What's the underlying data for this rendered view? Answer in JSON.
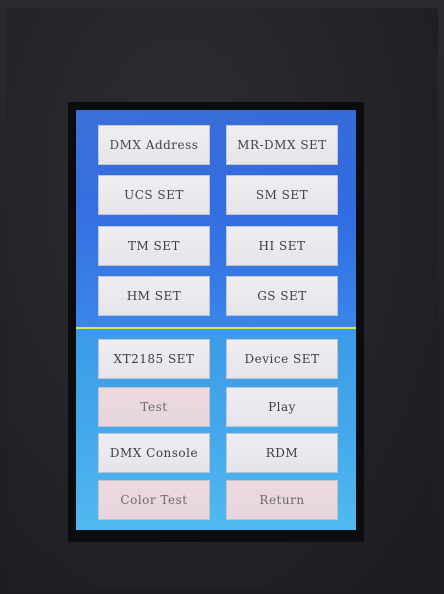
{
  "colors": {
    "screen_top": "#2f66d6",
    "screen_bottom": "#44a8ec",
    "divider": "#e8e437",
    "button_face": "#e8e8ee",
    "button_text": "#3a3d48"
  },
  "menu": {
    "buttons": [
      {
        "label": "DMX Address"
      },
      {
        "label": "MR-DMX SET"
      },
      {
        "label": "UCS SET"
      },
      {
        "label": "SM SET"
      },
      {
        "label": "TM SET"
      },
      {
        "label": "HI SET"
      },
      {
        "label": "HM SET"
      },
      {
        "label": "GS SET"
      },
      {
        "label": "XT2185 SET"
      },
      {
        "label": "Device SET"
      },
      {
        "label": "Test"
      },
      {
        "label": "Play"
      },
      {
        "label": "DMX Console"
      },
      {
        "label": "RDM"
      },
      {
        "label": "Color Test"
      },
      {
        "label": "Return"
      }
    ]
  }
}
